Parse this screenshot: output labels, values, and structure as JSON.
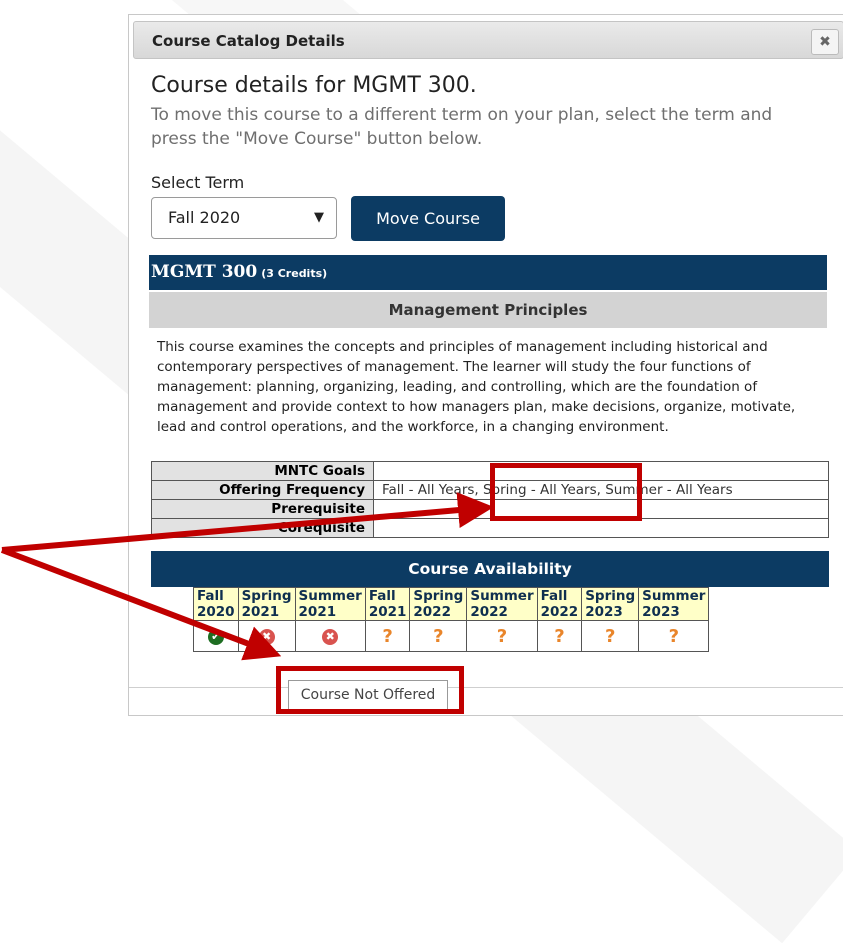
{
  "dialog": {
    "title": "Course Catalog Details",
    "close_icon": "✖",
    "heading": "Course details for MGMT 300.",
    "instructions": "To move this course to a different term on your plan, select the term and press the \"Move Course\" button below.",
    "select_label": "Select Term",
    "selected_term": "Fall 2020",
    "move_button": "Move Course"
  },
  "course": {
    "code": "MGMT 300",
    "credits": "(3 Credits)",
    "name": "Management Principles",
    "description": "This course examines the concepts and principles of management including historical and contemporary perspectives of management. The learner will study the four functions of management: planning, organizing, leading, and controlling, which are the foundation of management and provide context to how managers plan, make decisions, organize, motivate, lead and control operations, and the workforce, in a changing environment."
  },
  "info_rows": [
    {
      "label": "MNTC Goals",
      "value": ""
    },
    {
      "label": "Offering Frequency",
      "value": "Fall - All Years, Spring - All Years, Summer - All Years"
    },
    {
      "label": "Prerequisite",
      "value": ""
    },
    {
      "label": "Corequisite",
      "value": ""
    }
  ],
  "availability": {
    "title": "Course Availability",
    "terms": [
      {
        "season": "Fall",
        "year": "2020",
        "status": "offered"
      },
      {
        "season": "Spring",
        "year": "2021",
        "status": "not-offered"
      },
      {
        "season": "Summer",
        "year": "2021",
        "status": "not-offered"
      },
      {
        "season": "Fall",
        "year": "2021",
        "status": "unknown"
      },
      {
        "season": "Spring",
        "year": "2022",
        "status": "unknown"
      },
      {
        "season": "Summer",
        "year": "2022",
        "status": "unknown"
      },
      {
        "season": "Fall",
        "year": "2022",
        "status": "unknown"
      },
      {
        "season": "Spring",
        "year": "2023",
        "status": "unknown"
      },
      {
        "season": "Summer",
        "year": "2023",
        "status": "unknown"
      }
    ],
    "tooltip": "Course Not Offered"
  },
  "colors": {
    "accent": "#0c3b63",
    "highlight": "#c00000",
    "offered": "#1e6e22",
    "not_offered": "#d9534f",
    "unknown": "#e9852a"
  }
}
